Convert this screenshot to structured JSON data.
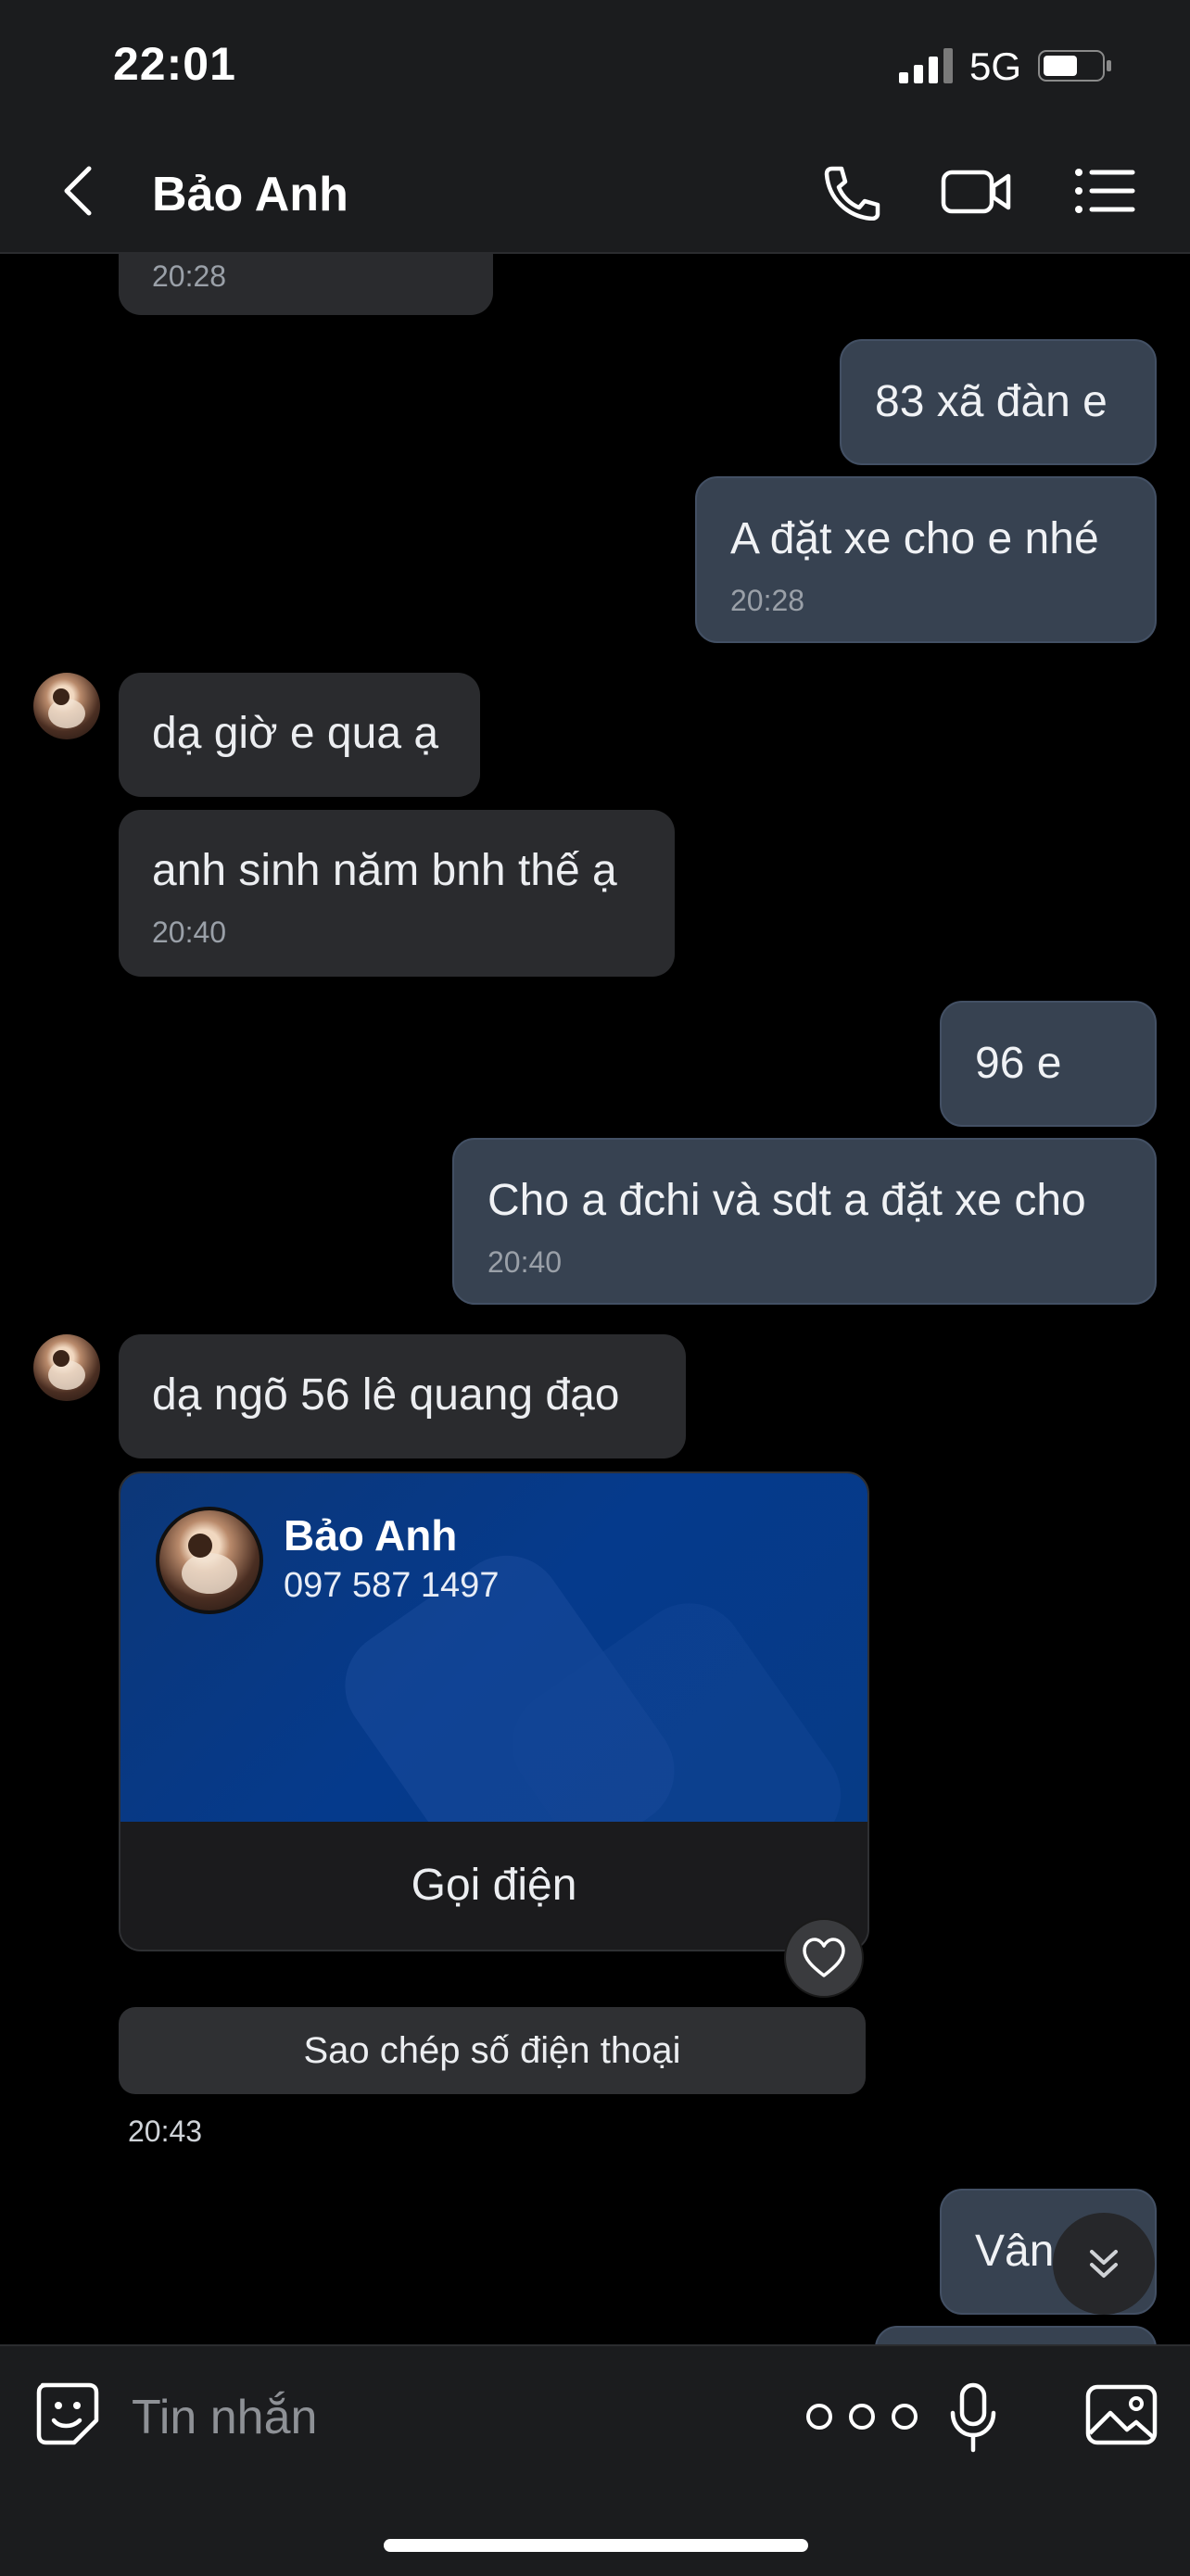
{
  "status_bar": {
    "time": "22:01",
    "network": "5G"
  },
  "header": {
    "title": "Bảo Anh",
    "icons": [
      "back-icon",
      "phone-icon",
      "video-icon",
      "menu-icon"
    ]
  },
  "messages": [
    {
      "dir": "in",
      "text": "",
      "time": "20:28"
    },
    {
      "dir": "out",
      "text": "83 xã đàn e"
    },
    {
      "dir": "out",
      "text": "A đặt xe cho e nhé",
      "time": "20:28"
    },
    {
      "dir": "in",
      "text": "dạ giờ e qua ạ"
    },
    {
      "dir": "in",
      "text": "anh sinh năm bnh thế ạ",
      "time": "20:40"
    },
    {
      "dir": "out",
      "text": "96 e"
    },
    {
      "dir": "out",
      "text": "Cho a đchi và sdt a đặt xe cho",
      "time": "20:40"
    },
    {
      "dir": "in",
      "text": "dạ ngõ 56 lê quang đạo"
    },
    {
      "dir": "out",
      "text": "Vâng"
    }
  ],
  "contact_card": {
    "name": "Bảo Anh",
    "phone": "097 587 1497",
    "call_label": "Gọi điện",
    "copy_label": "Sao chép số điện thoại",
    "time": "20:43"
  },
  "composer": {
    "placeholder": "Tin nhắn"
  },
  "colors": {
    "incoming_bubble": "#2a2b2e",
    "outgoing_bubble": "#374251",
    "card_blue": "#053a8c"
  }
}
